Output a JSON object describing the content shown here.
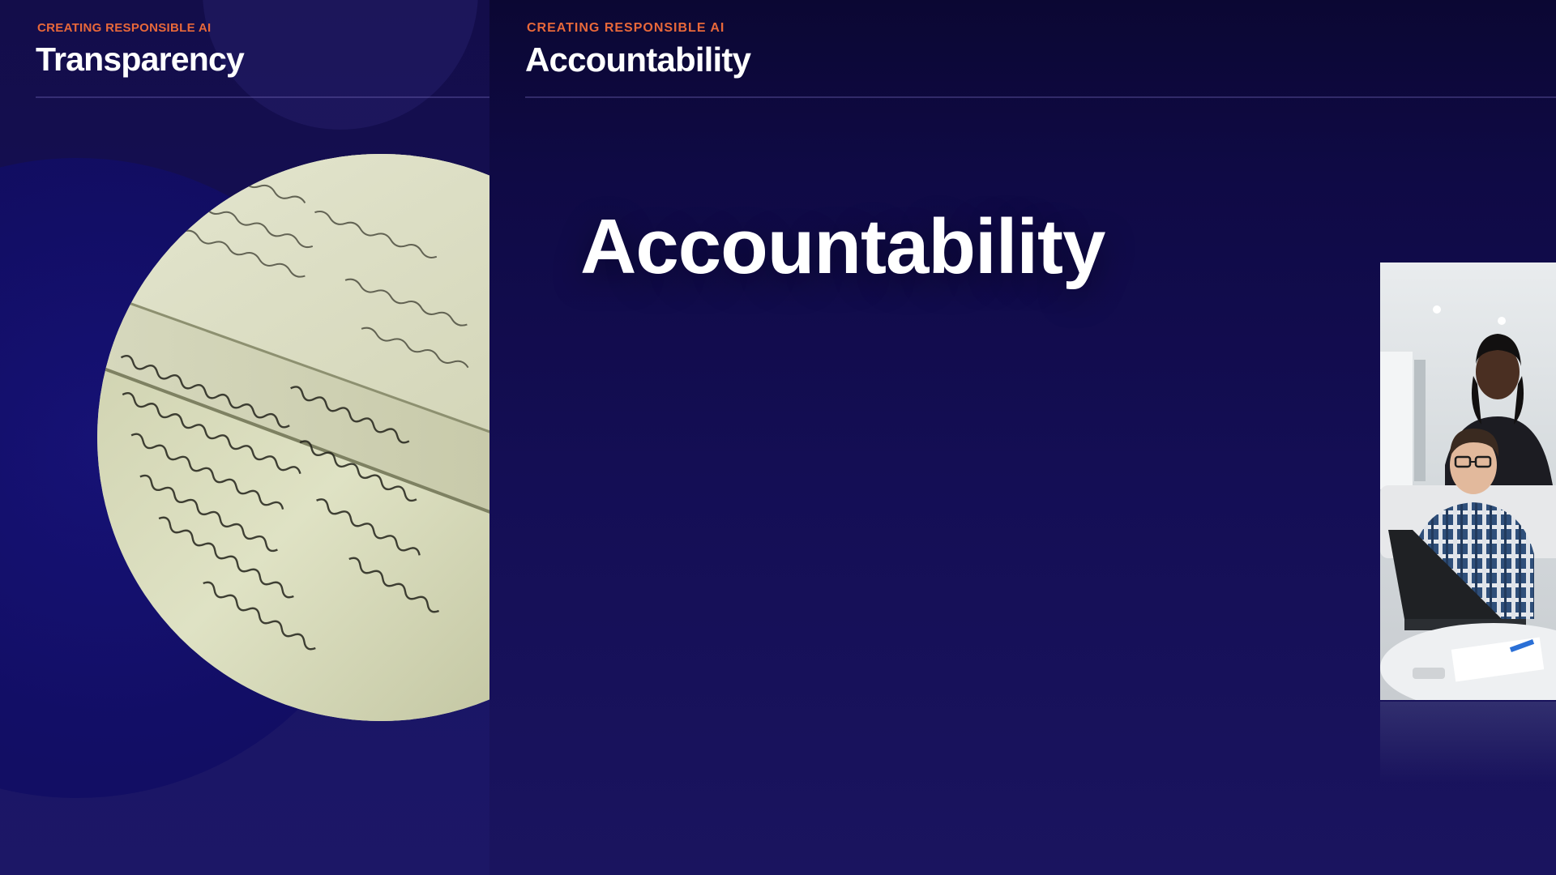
{
  "left_slide": {
    "eyebrow": "CREATING RESPONSIBLE AI",
    "title": "Transparency",
    "image": "handwritten-letters-photo"
  },
  "right_slide": {
    "eyebrow": "CREATING RESPONSIBLE AI",
    "title": "Accountability",
    "headline": "Accountability",
    "image": "office-team-laptop-photo"
  },
  "colors": {
    "accent": "#e8683a",
    "background_dark": "#0b0733",
    "background_mid": "#140e55",
    "text": "#ffffff"
  }
}
